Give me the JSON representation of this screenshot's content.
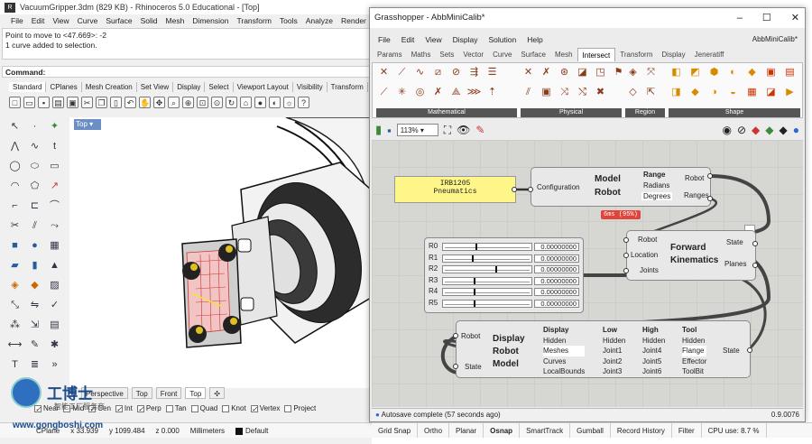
{
  "rhino": {
    "title": "VacuumGripper.3dm (829 KB) - Rhinoceros 5.0 Educational - [Top]",
    "menu": [
      "File",
      "Edit",
      "View",
      "Curve",
      "Surface",
      "Solid",
      "Mesh",
      "Dimension",
      "Transform",
      "Tools",
      "Analyze",
      "Render"
    ],
    "log_line1": "Point to move to <47.669>: -2",
    "log_line2": "1 curve added to selection.",
    "command_label": "Command:",
    "tabs": [
      "Standard",
      "CPlanes",
      "Mesh Creation",
      "Set View",
      "Display",
      "Select",
      "Viewport Layout",
      "Visibility",
      "Transform"
    ],
    "viewport_label": "Top",
    "viewport_tabs": [
      "Perspective",
      "Top",
      "Front",
      "Top"
    ],
    "osnaps": [
      {
        "label": "Near",
        "on": true
      },
      {
        "label": "Mid",
        "on": false
      },
      {
        "label": "Cen",
        "on": true
      },
      {
        "label": "Int",
        "on": true
      },
      {
        "label": "Perp",
        "on": true
      },
      {
        "label": "Tan",
        "on": false
      },
      {
        "label": "Quad",
        "on": false
      },
      {
        "label": "Knot",
        "on": false
      },
      {
        "label": "Vertex",
        "on": true
      },
      {
        "label": "Project",
        "on": false
      }
    ],
    "status": {
      "cplane": "CPlane",
      "x": "x 33.939",
      "y": "y 1099.484",
      "z": "z 0.000",
      "units": "Millimeters",
      "layer": "Default"
    }
  },
  "watermark": {
    "logo_text": "工博士",
    "sub": "智能工厂服务商",
    "url": "www.gongboshi.com"
  },
  "gh": {
    "title": "Grasshopper - AbbMiniCalib*",
    "doc": "AbbMiniCalib*",
    "menu": [
      "File",
      "Edit",
      "View",
      "Display",
      "Solution",
      "Help"
    ],
    "tabs": [
      "Params",
      "Maths",
      "Sets",
      "Vector",
      "Curve",
      "Surface",
      "Mesh",
      "Intersect",
      "Transform",
      "Display",
      "Jeneratiff"
    ],
    "active_tab": "Intersect",
    "groups": [
      "Mathematical",
      "Physical",
      "Region",
      "Shape"
    ],
    "zoom": "113%",
    "panel_text1": "IRB1205",
    "panel_text2": "Pneumatics",
    "model": {
      "input": "Configuration",
      "title1": "Model",
      "title2": "Robot",
      "params": [
        "Range",
        "Radians",
        "Degrees"
      ],
      "out1": "Robot",
      "out2": "Ranges"
    },
    "tooltip": "6ms (95%)",
    "sliders": [
      {
        "name": "R0",
        "value": "0.00000000",
        "pos": 0.38
      },
      {
        "name": "R1",
        "value": "0.00000000",
        "pos": 0.33
      },
      {
        "name": "R2",
        "value": "0.00000000",
        "pos": 0.6
      },
      {
        "name": "R3",
        "value": "0.00000000",
        "pos": 0.35
      },
      {
        "name": "R4",
        "value": "0.00000000",
        "pos": 0.35
      },
      {
        "name": "R5",
        "value": "0.00000000",
        "pos": 0.35
      }
    ],
    "fk": {
      "in": [
        "Robot",
        "Location",
        "Joints"
      ],
      "title1": "Forward",
      "title2": "Kinematics",
      "out": [
        "State",
        "Planes"
      ]
    },
    "drm": {
      "in": [
        "Robot",
        "State"
      ],
      "title": [
        "Display",
        "Robot",
        "Model"
      ],
      "col1": [
        "Display",
        "Hidden",
        "Meshes",
        "Curves",
        "LocalBounds"
      ],
      "col2": [
        "Low",
        "Hidden",
        "Joint1",
        "Joint2",
        "Joint3"
      ],
      "col3": [
        "High",
        "Hidden",
        "Joint4",
        "Joint5",
        "Joint6"
      ],
      "col4": [
        "Tool",
        "Hidden",
        "Flange",
        "Effector",
        "ToolBit"
      ],
      "out": "State"
    },
    "status_left": "Autosave complete (57 seconds ago)",
    "status_right": "0.9.0076"
  },
  "bottom_status": [
    "Grid Snap",
    "Ortho",
    "Planar",
    "Osnap",
    "SmartTrack",
    "Gumball",
    "Record History",
    "Filter",
    "CPU use: 8.7 %"
  ]
}
